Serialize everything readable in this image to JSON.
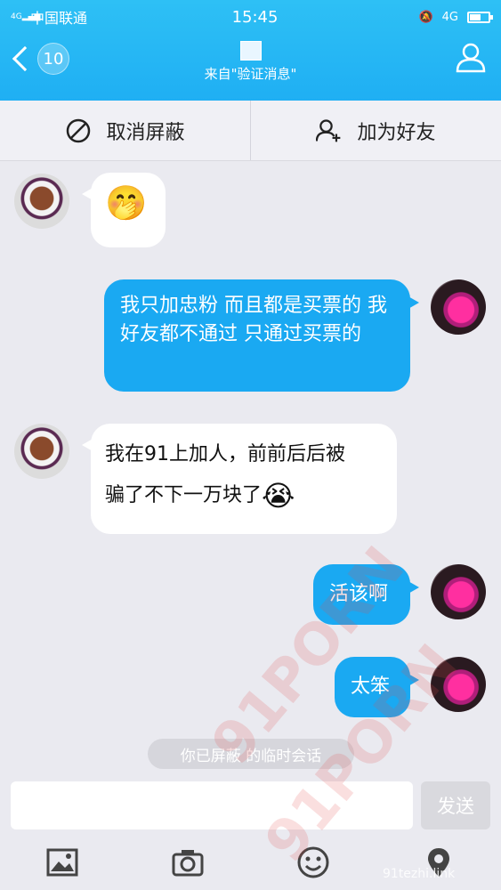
{
  "status": {
    "carrier": "中国联通",
    "time": "15:45",
    "network": "4G",
    "signal_tag": "4G"
  },
  "nav": {
    "badge_count": "10",
    "subtitle": "来自\"验证消息\""
  },
  "actions": {
    "unblock": "取消屏蔽",
    "add_friend": "加为好友"
  },
  "messages": [
    {
      "side": "in",
      "emoji": "🤭"
    },
    {
      "side": "out",
      "text": "我只加忠粉 而且都是买票的 我好友都不通过 只通过买票的"
    },
    {
      "side": "in",
      "text_line1": "我在91上加人，前前后后被",
      "text_line2": "骗了不下一万块了",
      "emoji": "😭"
    },
    {
      "side": "out",
      "text": "活该啊"
    },
    {
      "side": "out",
      "text": "太笨"
    }
  ],
  "system_note": "你已屏蔽    的临时会话",
  "input": {
    "send_label": "发送",
    "placeholder": ""
  },
  "watermark": {
    "site": "91tezhi.link",
    "overlay": "91PORN"
  }
}
